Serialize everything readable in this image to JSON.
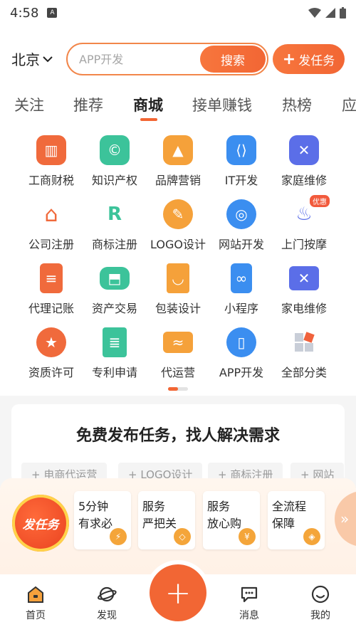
{
  "status_bar": {
    "time": "4:58",
    "notification_icon_label": "A"
  },
  "header": {
    "city": "北京",
    "search_placeholder": "APP开发",
    "search_button": "搜索",
    "post_task_button": "发任务"
  },
  "tabs": [
    {
      "label": "关注",
      "active": false
    },
    {
      "label": "推荐",
      "active": false
    },
    {
      "label": "商城",
      "active": true
    },
    {
      "label": "接单赚钱",
      "active": false
    },
    {
      "label": "热榜",
      "active": false
    },
    {
      "label": "应",
      "active": false
    }
  ],
  "grid": [
    {
      "label": "工商财税",
      "icon": "building-icon",
      "color": "#f06a3c"
    },
    {
      "label": "知识产权",
      "icon": "copyright-icon",
      "color": "#3cc39a"
    },
    {
      "label": "品牌营销",
      "icon": "chart-icon",
      "color": "#f5a13a"
    },
    {
      "label": "IT开发",
      "icon": "code-icon",
      "color": "#3b8ef0"
    },
    {
      "label": "家庭维修",
      "icon": "tools-icon",
      "color": "#5b6ee8"
    },
    {
      "label": "公司注册",
      "icon": "house-icon",
      "color": "#f06a3c"
    },
    {
      "label": "商标注册",
      "icon": "trademark-icon",
      "color": "#3cc39a"
    },
    {
      "label": "LOGO设计",
      "icon": "palette-icon",
      "color": "#f5a13a"
    },
    {
      "label": "网站开发",
      "icon": "globe-icon",
      "color": "#3b8ef0"
    },
    {
      "label": "上门按摩",
      "icon": "massage-icon",
      "color": "#5b6ee8",
      "badge": "优惠"
    },
    {
      "label": "代理记账",
      "icon": "clipboard-icon",
      "color": "#f06a3c"
    },
    {
      "label": "资产交易",
      "icon": "asset-icon",
      "color": "#3cc39a"
    },
    {
      "label": "包装设计",
      "icon": "bag-icon",
      "color": "#f5a13a"
    },
    {
      "label": "小程序",
      "icon": "miniapp-icon",
      "color": "#3b8ef0"
    },
    {
      "label": "家电维修",
      "icon": "toolbox-icon",
      "color": "#5b6ee8"
    },
    {
      "label": "资质许可",
      "icon": "medal-icon",
      "color": "#f06a3c"
    },
    {
      "label": "专利申请",
      "icon": "patent-icon",
      "color": "#3cc39a"
    },
    {
      "label": "代运营",
      "icon": "store-icon",
      "color": "#f5a13a"
    },
    {
      "label": "APP开发",
      "icon": "phone-icon",
      "color": "#3b8ef0"
    },
    {
      "label": "全部分类",
      "icon": "grid-icon",
      "color": "#9aa4b6"
    }
  ],
  "promo": {
    "title": "免费发布任务，找人解决需求",
    "chips": [
      "+ 电商代运营",
      "+ LOGO设计",
      "+ 商标注册",
      "+ 网站"
    ]
  },
  "strip": {
    "badge_label": "发任务",
    "features": [
      {
        "text": "5分钟\n有求必",
        "icon": "lightning-icon"
      },
      {
        "text": "服务\n严把关",
        "icon": "diamond-icon"
      },
      {
        "text": "服务\n放心购",
        "icon": "yen-icon"
      },
      {
        "text": "全流程\n保障",
        "icon": "shield-icon"
      }
    ]
  },
  "bottom_nav": [
    {
      "label": "首页",
      "icon": "home-icon",
      "active": true
    },
    {
      "label": "发现",
      "icon": "planet-icon",
      "active": false
    },
    {
      "label": "消息",
      "icon": "chat-icon",
      "active": false
    },
    {
      "label": "我的",
      "icon": "profile-icon",
      "active": false
    }
  ],
  "colors": {
    "accent": "#f26634"
  }
}
